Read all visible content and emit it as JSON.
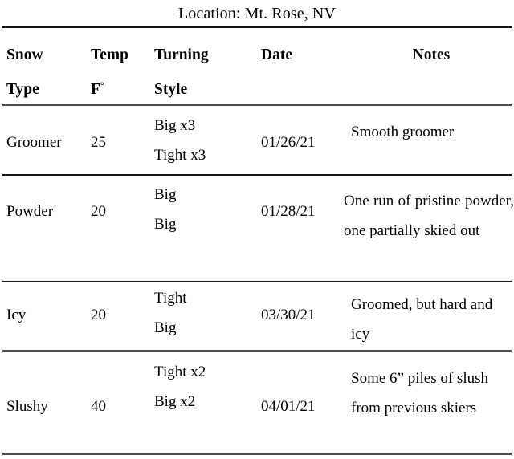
{
  "caption": "Location: Mt. Rose, NV",
  "columns": [
    {
      "id": "snow_type",
      "line1": "Snow",
      "line2": "Type"
    },
    {
      "id": "temp_f",
      "line1": "Temp",
      "line2": "F",
      "degree": "°"
    },
    {
      "id": "turning_style",
      "line1": "Turning",
      "line2": "Style"
    },
    {
      "id": "date",
      "line1": "Date",
      "line2": ""
    },
    {
      "id": "notes",
      "line1": "Notes",
      "line2": ""
    }
  ],
  "rows": [
    {
      "snow_type": "Groomer",
      "temp_f": "25",
      "turning_style_line1": "Big x3",
      "turning_style_line2": "Tight x3",
      "date": "01/26/21",
      "notes": "Smooth groomer"
    },
    {
      "snow_type": "Powder",
      "temp_f": "20",
      "turning_style_line1": "Big",
      "turning_style_line2": "Big",
      "date": "01/28/21",
      "notes": "One run of pristine powder, one partially skied out"
    },
    {
      "snow_type": "Icy",
      "temp_f": "20",
      "turning_style_line1": "Tight",
      "turning_style_line2": "Big",
      "date": "03/30/21",
      "notes": "Groomed, but hard and icy"
    },
    {
      "snow_type": "Slushy",
      "temp_f": "40",
      "turning_style_line1": "Tight x2",
      "turning_style_line2": "Big x2",
      "date": "04/01/21",
      "notes": "Some 6” piles of slush from previous skiers"
    }
  ],
  "colors": {
    "text": "#000000",
    "rule": "#1b1b1b",
    "background": "#ffffff"
  }
}
